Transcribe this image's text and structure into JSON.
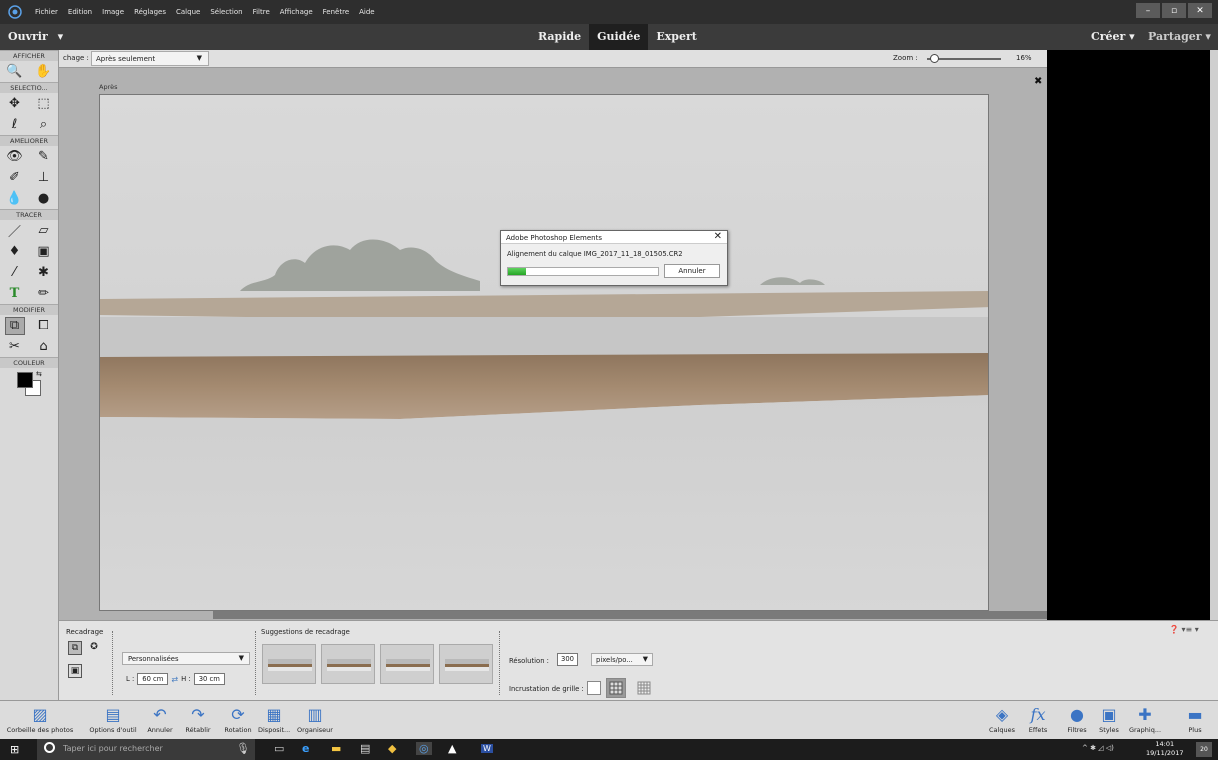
{
  "menubar": {
    "items": [
      "Fichier",
      "Edition",
      "Image",
      "Réglages",
      "Calque",
      "Sélection",
      "Filtre",
      "Affichage",
      "Fenêtre",
      "Aide"
    ],
    "controls": [
      "–",
      "▫",
      "✕"
    ]
  },
  "modebar": {
    "open_label": "Ouvrir",
    "open_arrow": "▾",
    "modes": [
      "Rapide",
      "Guidée",
      "Expert"
    ],
    "active_mode": "Guidée",
    "create_label": "Créer ▾",
    "share_label": "Partager ▾"
  },
  "toolbar": {
    "sections": {
      "view": "AFFICHER",
      "select": "SELECTIO...",
      "enhance": "AMELIORER",
      "draw": "TRACER",
      "modify": "MODIFIER",
      "color": "COULEUR"
    },
    "tools": {
      "zoom": "🔍",
      "hand": "✋",
      "move": "✥",
      "marquee": "⬚",
      "lasso": "ℓ",
      "quick_select": "⌕",
      "eye": "👁",
      "spot_heal": "✎",
      "smart_brush": "✐",
      "clone": "⊥",
      "blur": "💧",
      "sponge": "●",
      "brush": "／",
      "eraser": "▱",
      "bucket": "♦",
      "gradient": "▣",
      "eyedropper": "⁄",
      "shape": "✱",
      "text": "T",
      "pencil": "✏",
      "crop": "⧉",
      "recompose": "⧠",
      "straighten": "✂",
      "content_move": "⌂"
    }
  },
  "options": {
    "view_label": "chage :",
    "view_value": "Après seulement",
    "zoom_label": "Zoom :",
    "zoom_value": "16%",
    "zoom_level": 0.1
  },
  "canvas": {
    "after_label": "Après",
    "close": "✖"
  },
  "dialog": {
    "title": "Adobe Photoshop Elements",
    "close": "✕",
    "message": "Alignement du calque IMG_2017_11_18_01505.CR2",
    "progress": 0.12,
    "cancel_label": "Annuler"
  },
  "tooloptions": {
    "title": "Recadrage",
    "preset": "Personnalisées",
    "width_label": "L :",
    "width_value": "60 cm",
    "height_label": "H :",
    "height_value": "30 cm",
    "suggestions_title": "Suggestions de recadrage",
    "resolution_label": "Résolution :",
    "resolution_value": "300",
    "resolution_unit": "pixels/po...",
    "grid_label": "Incrustation de grille :",
    "help": "❓ ▾≡ ▾"
  },
  "taskbar": {
    "buttons": [
      {
        "label": "Corbeille des photos",
        "icon": "▨"
      },
      {
        "label": "Options d'outil",
        "icon": "▤"
      },
      {
        "label": "Annuler",
        "icon": "↶"
      },
      {
        "label": "Rétablir",
        "icon": "↷"
      },
      {
        "label": "Rotation",
        "icon": "⟳"
      },
      {
        "label": "Disposit...",
        "icon": "▦"
      },
      {
        "label": "Organiseur",
        "icon": "▥"
      }
    ],
    "panels": [
      {
        "label": "Calques",
        "icon": "◈"
      },
      {
        "label": "Effets",
        "icon": "fx"
      },
      {
        "label": "Filtres",
        "icon": "●"
      },
      {
        "label": "Styles",
        "icon": "▣"
      },
      {
        "label": "Graphiq...",
        "icon": "✚"
      },
      {
        "label": "Plus",
        "icon": "▬"
      }
    ]
  },
  "windows": {
    "search_placeholder": "Taper ici pour rechercher",
    "time": "14:01",
    "date": "19/11/2017",
    "notifications": "20",
    "tray": "^ ✱ ◿ ◁)"
  },
  "colors": {
    "menubar": "#2e2e2e",
    "modebar": "#3b3b3b",
    "active_mode": "#1f1f1f",
    "progress": "#26a526",
    "accent": "#3b74c4"
  }
}
